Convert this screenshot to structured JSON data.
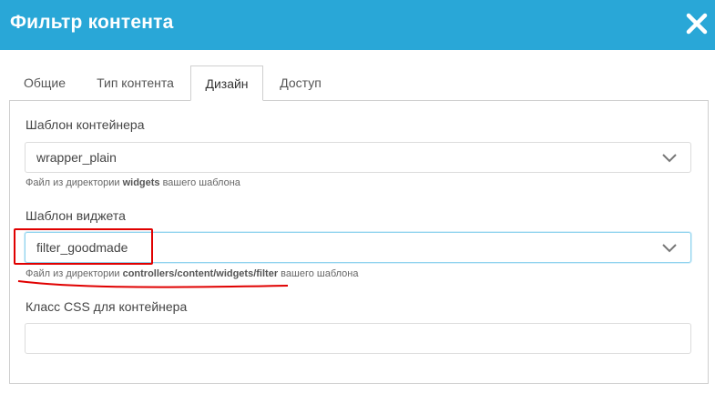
{
  "dialog": {
    "title": "Фильтр контента",
    "close_icon": "close-icon"
  },
  "tabs": [
    {
      "label": "Общие",
      "active": false
    },
    {
      "label": "Тип контента",
      "active": false
    },
    {
      "label": "Дизайн",
      "active": true
    },
    {
      "label": "Доступ",
      "active": false
    }
  ],
  "fields": {
    "container_template": {
      "label": "Шаблон контейнера",
      "value": "wrapper_plain",
      "hint_prefix": "Файл из директории ",
      "hint_bold": "widgets",
      "hint_suffix": " вашего шаблона"
    },
    "widget_template": {
      "label": "Шаблон виджета",
      "value": "filter_goodmade",
      "hint_prefix": "Файл из директории ",
      "hint_bold": "controllers/content/widgets/filter",
      "hint_suffix": " вашего шаблона"
    },
    "container_css": {
      "label": "Класс CSS для контейнера",
      "value": ""
    }
  },
  "colors": {
    "titlebar": "#29a7d7",
    "annotation": "#e00000"
  }
}
